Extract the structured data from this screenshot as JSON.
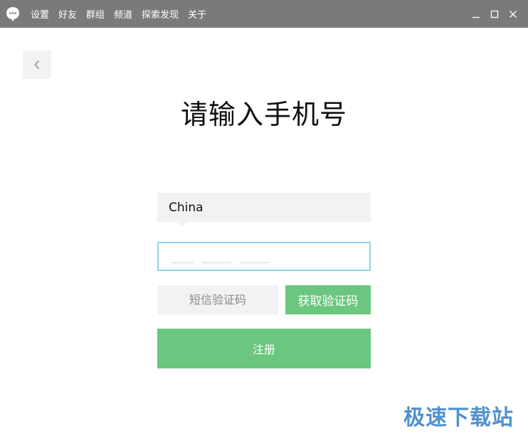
{
  "titlebar": {
    "menu": [
      {
        "id": "settings",
        "label": "设置"
      },
      {
        "id": "friends",
        "label": "好友"
      },
      {
        "id": "groups",
        "label": "群组"
      },
      {
        "id": "channels",
        "label": "频道"
      },
      {
        "id": "explore",
        "label": "探索发现"
      },
      {
        "id": "about",
        "label": "关于"
      }
    ],
    "icons": {
      "app": "chat-bubble-icon",
      "minimize": "minimize-icon",
      "maximize": "maximize-icon",
      "close": "close-icon"
    },
    "background_color": "#7a7a7a"
  },
  "back_button": {
    "icon": "chevron-left-icon"
  },
  "page": {
    "title": "请输入手机号"
  },
  "form": {
    "country": "China",
    "phone": {
      "value": "",
      "placeholder": "___ ____ ____"
    },
    "sms_code": {
      "value": "",
      "placeholder": "短信验证码"
    },
    "get_code_label": "获取验证码",
    "register_label": "注册"
  },
  "watermark": "极速下载站",
  "colors": {
    "accent_green": "#6bc77f",
    "input_focus_border": "#8fd3e6",
    "field_background": "#f2f2f2",
    "watermark_blue": "#3f86c8"
  }
}
